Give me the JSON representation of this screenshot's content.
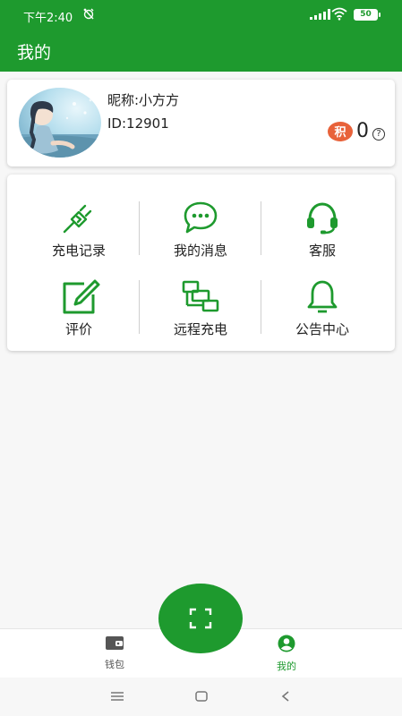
{
  "status_bar": {
    "time": "下午2:40",
    "battery": "50"
  },
  "header": {
    "title": "我的"
  },
  "profile": {
    "nickname": "昵称:小方方",
    "user_id": "ID:12901",
    "points_badge": "积",
    "points_value": "0",
    "help_mark": "?"
  },
  "menu": [
    {
      "label": "充电记录",
      "icon": "charging-plug-icon"
    },
    {
      "label": "我的消息",
      "icon": "chat-bubble-icon"
    },
    {
      "label": "客服",
      "icon": "headset-icon"
    },
    {
      "label": "评价",
      "icon": "edit-icon"
    },
    {
      "label": "远程充电",
      "icon": "remote-network-icon"
    },
    {
      "label": "公告中心",
      "icon": "bell-icon"
    }
  ],
  "tabbar": {
    "wallet_label": "钱包",
    "mine_label": "我的",
    "scan_icon": "scan-icon"
  },
  "colors": {
    "brand": "#1e9a2e",
    "points_badge": "#e8623a",
    "inactive_tab": "#555555"
  }
}
